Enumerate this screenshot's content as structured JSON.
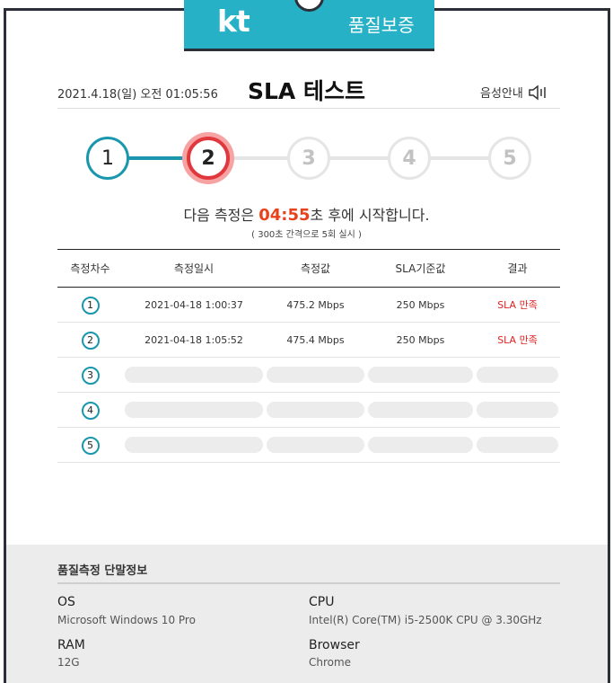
{
  "brand": {
    "logo": "kt",
    "title": "품질보증"
  },
  "header": {
    "datetime": "2021.4.18(일) 오전 01:05:56",
    "title": "SLA 테스트",
    "voice_label": "음성안내"
  },
  "steps": [
    {
      "label": "1",
      "state": "done"
    },
    {
      "label": "2",
      "state": "active"
    },
    {
      "label": "3",
      "state": "pending"
    },
    {
      "label": "4",
      "state": "pending"
    },
    {
      "label": "5",
      "state": "pending"
    }
  ],
  "next": {
    "prefix": "다음 측정은 ",
    "time": "04:55",
    "suffix": "초 후에 시작합니다.",
    "note": "( 300초 간격으로 5회 실시 )"
  },
  "table": {
    "headers": [
      "측정차수",
      "측정일시",
      "측정값",
      "SLA기준값",
      "결과"
    ],
    "rows": [
      {
        "num": "1",
        "datetime": "2021-04-18 1:00:37",
        "value": "475.2 Mbps",
        "sla": "250 Mbps",
        "result": "SLA 만족"
      },
      {
        "num": "2",
        "datetime": "2021-04-18 1:05:52",
        "value": "475.4 Mbps",
        "sla": "250 Mbps",
        "result": "SLA 만족"
      },
      {
        "num": "3"
      },
      {
        "num": "4"
      },
      {
        "num": "5"
      }
    ]
  },
  "device": {
    "title": "품질측정 단말정보",
    "os_label": "OS",
    "os": "Microsoft Windows 10 Pro",
    "cpu_label": "CPU",
    "cpu": "Intel(R) Core(TM) i5-2500K CPU @ 3.30GHz",
    "ram_label": "RAM",
    "ram": "12G",
    "browser_label": "Browser",
    "browser": "Chrome"
  },
  "colors": {
    "accent": "#27b1c7",
    "step_done": "#1a97ad",
    "step_active": "#e0383c",
    "countdown": "#e8411b",
    "result_ok": "#e02020"
  }
}
